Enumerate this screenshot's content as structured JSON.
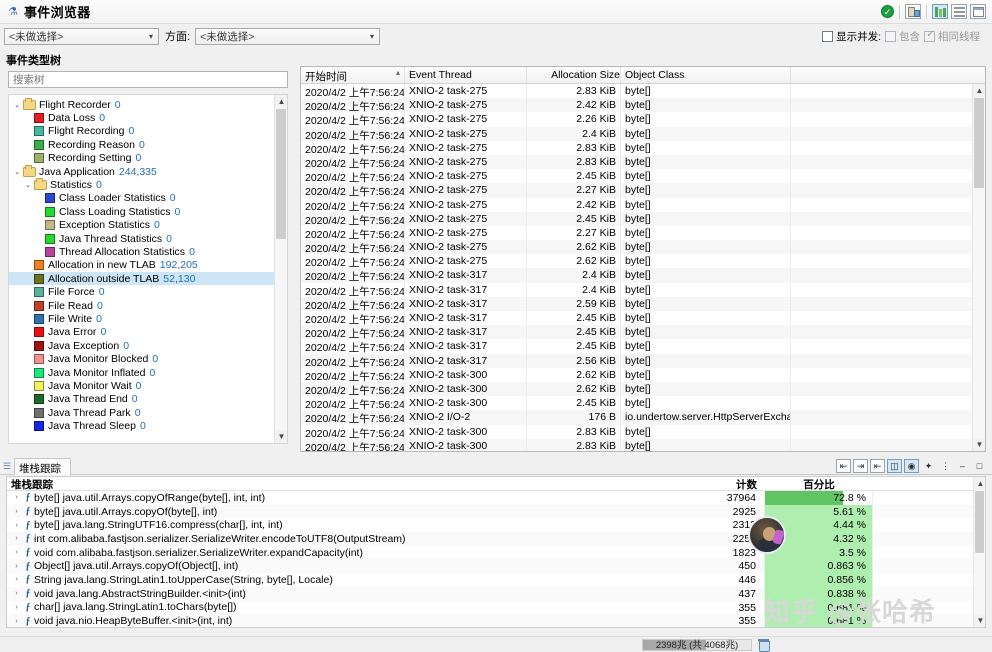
{
  "window": {
    "title": "事件浏览器",
    "icon": "flask-icon"
  },
  "toolbar": {
    "status_ok": "✓",
    "icons": [
      "table-column-icon",
      "chart-bars-icon",
      "list-rows-icon",
      "grid-icon"
    ]
  },
  "filter_bar": {
    "combo_primary_value": "<未做选择>",
    "aspect_label": "方面:",
    "combo_aspect_value": "<未做选择>",
    "checkbox_show_concurrent": "显示并发:",
    "checkbox_contains": "包含",
    "checkbox_same_thread": "相同线程"
  },
  "event_tree": {
    "header": "事件类型树",
    "search_placeholder": "搜索树",
    "nodes": [
      {
        "indent": 0,
        "twisty": "⌄",
        "kind": "folder",
        "label": "Flight Recorder",
        "count": "0",
        "selected": false
      },
      {
        "indent": 1,
        "twisty": "",
        "kind": "swatch",
        "color": "#e02020",
        "label": "Data Loss",
        "count": "0",
        "selected": false
      },
      {
        "indent": 1,
        "twisty": "",
        "kind": "swatch",
        "color": "#45b8a0",
        "label": "Flight Recording",
        "count": "0",
        "selected": false
      },
      {
        "indent": 1,
        "twisty": "",
        "kind": "swatch",
        "color": "#3cae4e",
        "label": "Recording Reason",
        "count": "0",
        "selected": false
      },
      {
        "indent": 1,
        "twisty": "",
        "kind": "swatch",
        "color": "#9cb06a",
        "label": "Recording Setting",
        "count": "0",
        "selected": false
      },
      {
        "indent": 0,
        "twisty": "⌄",
        "kind": "folder",
        "label": "Java Application",
        "count": "244,335",
        "selected": false
      },
      {
        "indent": 1,
        "twisty": "⌄",
        "kind": "folder",
        "label": "Statistics",
        "count": "0",
        "selected": false
      },
      {
        "indent": 2,
        "twisty": "",
        "kind": "swatch",
        "color": "#2f46cf",
        "label": "Class Loader Statistics",
        "count": "0",
        "selected": false
      },
      {
        "indent": 2,
        "twisty": "",
        "kind": "swatch",
        "color": "#25d72f",
        "label": "Class Loading Statistics",
        "count": "0",
        "selected": false
      },
      {
        "indent": 2,
        "twisty": "",
        "kind": "swatch",
        "color": "#c2b98a",
        "label": "Exception Statistics",
        "count": "0",
        "selected": false
      },
      {
        "indent": 2,
        "twisty": "",
        "kind": "swatch",
        "color": "#25d72f",
        "label": "Java Thread Statistics",
        "count": "0",
        "selected": false
      },
      {
        "indent": 2,
        "twisty": "",
        "kind": "swatch",
        "color": "#b8449c",
        "label": "Thread Allocation Statistics",
        "count": "0",
        "selected": false
      },
      {
        "indent": 1,
        "twisty": "",
        "kind": "swatch",
        "color": "#f08020",
        "label": "Allocation in new TLAB",
        "count": "192,205",
        "selected": false
      },
      {
        "indent": 1,
        "twisty": "",
        "kind": "swatch",
        "color": "#6d7020",
        "label": "Allocation outside TLAB",
        "count": "52,130",
        "selected": true
      },
      {
        "indent": 1,
        "twisty": "",
        "kind": "swatch",
        "color": "#58b49a",
        "label": "File Force",
        "count": "0",
        "selected": false
      },
      {
        "indent": 1,
        "twisty": "",
        "kind": "swatch",
        "color": "#c0412a",
        "label": "File Read",
        "count": "0",
        "selected": false
      },
      {
        "indent": 1,
        "twisty": "",
        "kind": "swatch",
        "color": "#2e73b0",
        "label": "File Write",
        "count": "0",
        "selected": false
      },
      {
        "indent": 1,
        "twisty": "",
        "kind": "swatch",
        "color": "#e81010",
        "label": "Java Error",
        "count": "0",
        "selected": false
      },
      {
        "indent": 1,
        "twisty": "",
        "kind": "swatch",
        "color": "#9c1414",
        "label": "Java Exception",
        "count": "0",
        "selected": false
      },
      {
        "indent": 1,
        "twisty": "",
        "kind": "swatch",
        "color": "#f2918c",
        "label": "Java Monitor Blocked",
        "count": "0",
        "selected": false
      },
      {
        "indent": 1,
        "twisty": "",
        "kind": "swatch",
        "color": "#1ce87a",
        "label": "Java Monitor Inflated",
        "count": "0",
        "selected": false
      },
      {
        "indent": 1,
        "twisty": "",
        "kind": "swatch",
        "color": "#f5ef60",
        "label": "Java Monitor Wait",
        "count": "0",
        "selected": false
      },
      {
        "indent": 1,
        "twisty": "",
        "kind": "swatch",
        "color": "#1d6a2a",
        "label": "Java Thread End",
        "count": "0",
        "selected": false
      },
      {
        "indent": 1,
        "twisty": "",
        "kind": "swatch",
        "color": "#707070",
        "label": "Java Thread Park",
        "count": "0",
        "selected": false
      },
      {
        "indent": 1,
        "twisty": "",
        "kind": "swatch",
        "color": "#1425e8",
        "label": "Java Thread Sleep",
        "count": "0",
        "selected": false
      }
    ]
  },
  "events_table": {
    "columns": [
      {
        "label": "开始时间",
        "sorted": true
      },
      {
        "label": "Event Thread",
        "sorted": false
      },
      {
        "label": "Allocation Size",
        "sorted": false
      },
      {
        "label": "Object Class",
        "sorted": false
      }
    ],
    "rows": [
      {
        "time": "2020/4/2 上午7:56:24",
        "thread": "XNIO-2 task-275",
        "size": "2.83 KiB",
        "cls": "byte[]"
      },
      {
        "time": "2020/4/2 上午7:56:24",
        "thread": "XNIO-2 task-275",
        "size": "2.42 KiB",
        "cls": "byte[]"
      },
      {
        "time": "2020/4/2 上午7:56:24",
        "thread": "XNIO-2 task-275",
        "size": "2.26 KiB",
        "cls": "byte[]"
      },
      {
        "time": "2020/4/2 上午7:56:24",
        "thread": "XNIO-2 task-275",
        "size": "2.4 KiB",
        "cls": "byte[]"
      },
      {
        "time": "2020/4/2 上午7:56:24",
        "thread": "XNIO-2 task-275",
        "size": "2.83 KiB",
        "cls": "byte[]"
      },
      {
        "time": "2020/4/2 上午7:56:24",
        "thread": "XNIO-2 task-275",
        "size": "2.83 KiB",
        "cls": "byte[]"
      },
      {
        "time": "2020/4/2 上午7:56:24",
        "thread": "XNIO-2 task-275",
        "size": "2.45 KiB",
        "cls": "byte[]"
      },
      {
        "time": "2020/4/2 上午7:56:24",
        "thread": "XNIO-2 task-275",
        "size": "2.27 KiB",
        "cls": "byte[]"
      },
      {
        "time": "2020/4/2 上午7:56:24",
        "thread": "XNIO-2 task-275",
        "size": "2.42 KiB",
        "cls": "byte[]"
      },
      {
        "time": "2020/4/2 上午7:56:24",
        "thread": "XNIO-2 task-275",
        "size": "2.45 KiB",
        "cls": "byte[]"
      },
      {
        "time": "2020/4/2 上午7:56:24",
        "thread": "XNIO-2 task-275",
        "size": "2.27 KiB",
        "cls": "byte[]"
      },
      {
        "time": "2020/4/2 上午7:56:24",
        "thread": "XNIO-2 task-275",
        "size": "2.62 KiB",
        "cls": "byte[]"
      },
      {
        "time": "2020/4/2 上午7:56:24",
        "thread": "XNIO-2 task-275",
        "size": "2.62 KiB",
        "cls": "byte[]"
      },
      {
        "time": "2020/4/2 上午7:56:24",
        "thread": "XNIO-2 task-317",
        "size": "2.4 KiB",
        "cls": "byte[]"
      },
      {
        "time": "2020/4/2 上午7:56:24",
        "thread": "XNIO-2 task-317",
        "size": "2.4 KiB",
        "cls": "byte[]"
      },
      {
        "time": "2020/4/2 上午7:56:24",
        "thread": "XNIO-2 task-317",
        "size": "2.59 KiB",
        "cls": "byte[]"
      },
      {
        "time": "2020/4/2 上午7:56:24",
        "thread": "XNIO-2 task-317",
        "size": "2.45 KiB",
        "cls": "byte[]"
      },
      {
        "time": "2020/4/2 上午7:56:24",
        "thread": "XNIO-2 task-317",
        "size": "2.45 KiB",
        "cls": "byte[]"
      },
      {
        "time": "2020/4/2 上午7:56:24",
        "thread": "XNIO-2 task-317",
        "size": "2.45 KiB",
        "cls": "byte[]"
      },
      {
        "time": "2020/4/2 上午7:56:24",
        "thread": "XNIO-2 task-317",
        "size": "2.56 KiB",
        "cls": "byte[]"
      },
      {
        "time": "2020/4/2 上午7:56:24",
        "thread": "XNIO-2 task-300",
        "size": "2.62 KiB",
        "cls": "byte[]"
      },
      {
        "time": "2020/4/2 上午7:56:24",
        "thread": "XNIO-2 task-300",
        "size": "2.62 KiB",
        "cls": "byte[]"
      },
      {
        "time": "2020/4/2 上午7:56:24",
        "thread": "XNIO-2 task-300",
        "size": "2.45 KiB",
        "cls": "byte[]"
      },
      {
        "time": "2020/4/2 上午7:56:24",
        "thread": "XNIO-2 I/O-2",
        "size": "176 B",
        "cls": "io.undertow.server.HttpServerExchange"
      },
      {
        "time": "2020/4/2 上午7:56:24",
        "thread": "XNIO-2 task-300",
        "size": "2.83 KiB",
        "cls": "byte[]"
      },
      {
        "time": "2020/4/2 上午7:56:24",
        "thread": "XNIO-2 task-300",
        "size": "2.83 KiB",
        "cls": "byte[]"
      }
    ]
  },
  "stack_trace": {
    "tab_label": "堆栈跟踪",
    "header": "堆栈跟踪",
    "columns": {
      "name": "堆栈跟踪",
      "count": "计数",
      "percent": "百分比"
    },
    "tool_icons": [
      "first-frame-icon",
      "prev-frame-icon",
      "next-frame-icon",
      "tree-view-icon",
      "clock-icon",
      "pin-icon",
      "more-options-icon",
      "minimize-icon",
      "maximize-icon"
    ],
    "frames": [
      {
        "name": "byte[] java.util.Arrays.copyOfRange(byte[], int, int)",
        "count": "37964",
        "percent": "72.8 %",
        "pct_num": 72.8
      },
      {
        "name": "byte[] java.util.Arrays.copyOf(byte[], int)",
        "count": "2925",
        "percent": "5.61 %",
        "pct_num": 5.61
      },
      {
        "name": "byte[] java.lang.StringUTF16.compress(char[], int, int)",
        "count": "2312",
        "percent": "4.44 %",
        "pct_num": 4.44
      },
      {
        "name": "int com.alibaba.fastjson.serializer.SerializeWriter.encodeToUTF8(OutputStream)",
        "count": "2250",
        "percent": "4.32 %",
        "pct_num": 4.32
      },
      {
        "name": "void com.alibaba.fastjson.serializer.SerializeWriter.expandCapacity(int)",
        "count": "1823",
        "percent": "3.5 %",
        "pct_num": 3.5
      },
      {
        "name": "Object[] java.util.Arrays.copyOf(Object[], int)",
        "count": "450",
        "percent": "0.863 %",
        "pct_num": 0.863
      },
      {
        "name": "String java.lang.StringLatin1.toUpperCase(String, byte[], Locale)",
        "count": "446",
        "percent": "0.856 %",
        "pct_num": 0.856
      },
      {
        "name": "void java.lang.AbstractStringBuilder.<init>(int)",
        "count": "437",
        "percent": "0.838 %",
        "pct_num": 0.838
      },
      {
        "name": "char[] java.lang.StringLatin1.toChars(byte[])",
        "count": "355",
        "percent": "0.681 %",
        "pct_num": 0.681
      },
      {
        "name": "void java.nio.HeapByteBuffer.<init>(int, int)",
        "count": "355",
        "percent": "0.681 %",
        "pct_num": 0.681
      }
    ]
  },
  "status_bar": {
    "memory": "2398兆 (共 4068兆)",
    "trash_icon": "trash-icon"
  },
  "overlay": {
    "watermark": "知乎 @张哈希"
  },
  "colors": {
    "accent": "#1f6fbd",
    "selection": "#cce6f7",
    "bar_strong": "#63c463",
    "bar_light": "#aeeeae",
    "ok_green": "#1a9e3f"
  }
}
